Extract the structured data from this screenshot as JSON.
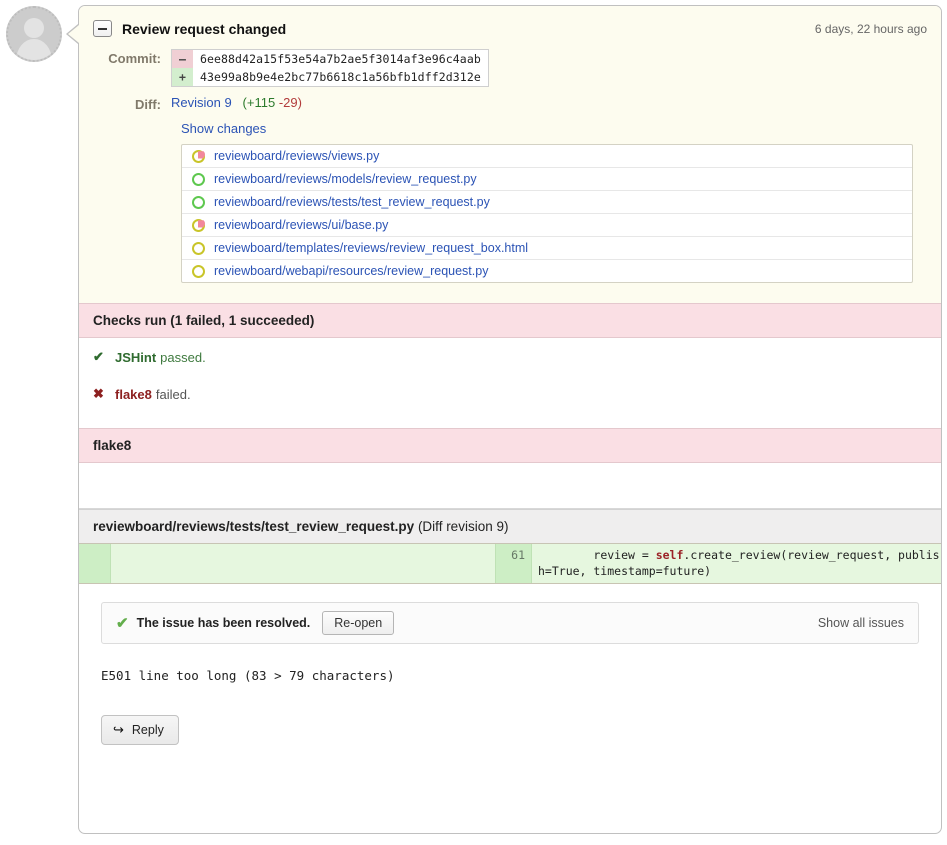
{
  "avatar": {
    "name": "user-avatar"
  },
  "header": {
    "title": "Review request changed",
    "timestamp": "6 days, 22 hours ago",
    "collapse_icon": "collapse-minus-icon"
  },
  "fields": {
    "commit_label": "Commit:",
    "commit_old_sign": "–",
    "commit_old_hash": "6ee88d42a15f53e54a7b2ae5f3014af3e96c4aab",
    "commit_new_sign": "+",
    "commit_new_hash": "43e99a8b9e4e2bc77b6618c1a56bfb1dff2d312e",
    "diff_label": "Diff:",
    "diff_revision": "Revision 9",
    "diff_insertions": "(+115",
    "diff_deletions": "-29)",
    "show_changes": "Show changes"
  },
  "files": [
    {
      "name": "reviewboard/reviews/views.py",
      "icon": "progress-ring-icon",
      "state": "partial"
    },
    {
      "name": "reviewboard/reviews/models/review_request.py",
      "icon": "progress-ring-icon",
      "state": "green"
    },
    {
      "name": "reviewboard/reviews/tests/test_review_request.py",
      "icon": "progress-ring-icon",
      "state": "green"
    },
    {
      "name": "reviewboard/reviews/ui/base.py",
      "icon": "progress-ring-icon",
      "state": "partial"
    },
    {
      "name": "reviewboard/templates/reviews/review_request_box.html",
      "icon": "progress-ring-icon",
      "state": "yellow"
    },
    {
      "name": "reviewboard/webapi/resources/review_request.py",
      "icon": "progress-ring-icon",
      "state": "yellow"
    }
  ],
  "checks": {
    "heading": "Checks run (1 failed, 1 succeeded)",
    "results": [
      {
        "icon": "✔",
        "icon_name": "check-success-icon",
        "name": "JSHint",
        "state": "passed.",
        "status": "ok"
      },
      {
        "icon": "✖",
        "icon_name": "check-failure-icon",
        "name": "flake8",
        "state": "failed.",
        "status": "fail"
      }
    ]
  },
  "flake8_section": {
    "heading": "flake8"
  },
  "diff_file": {
    "filename": "reviewboard/reviews/tests/test_review_request.py",
    "revision": "(Diff revision 9)",
    "line_number": "61",
    "code_pre": "        review = ",
    "code_kw": "self",
    "code_post": ".create_review(review_request, publish=True, timestamp=future)"
  },
  "issue": {
    "check_icon": "✔",
    "text": "The issue has been resolved.",
    "reopen_label": "Re-open",
    "show_all_label": "Show all issues"
  },
  "comment": {
    "text": "E501 line too long (83 > 79 characters)"
  },
  "reply": {
    "arrow_icon": "↩",
    "label": "Reply"
  },
  "colors": {
    "cream": "#fdfcef",
    "pink_header": "#fadfe4",
    "link": "#2b53b5",
    "diff_green_light": "#e6f7df",
    "diff_green_gutter": "#cdeec5",
    "success": "#2f6b2f",
    "failure": "#8d2020"
  }
}
